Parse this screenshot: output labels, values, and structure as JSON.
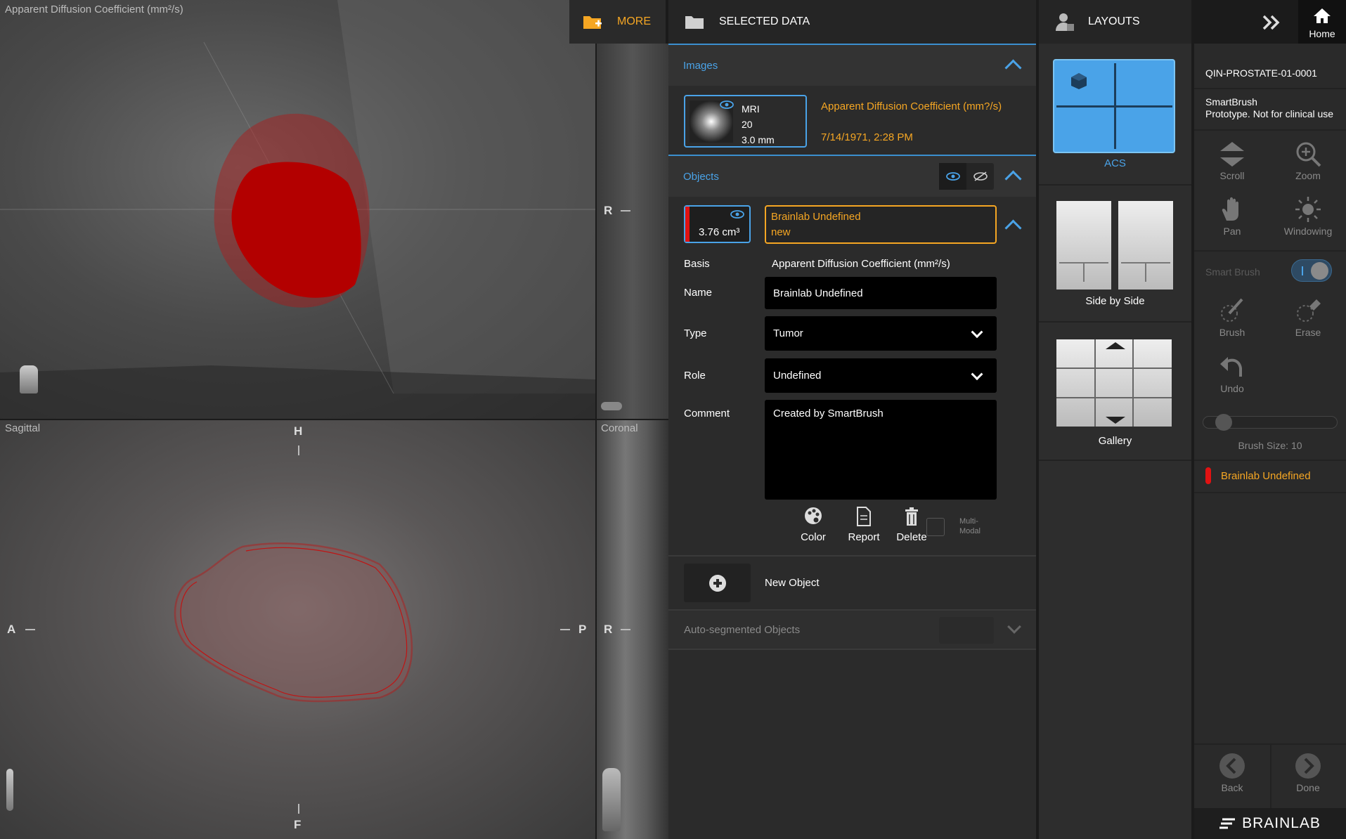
{
  "viewer": {
    "top_label": "Apparent Diffusion Coefficient (mm²/s)",
    "sagittal_label": "Sagittal",
    "coronal_label": "Coronal",
    "orient_3d_r": "R",
    "orient_sag_h": "H",
    "orient_sag_f": "F",
    "orient_sag_a": "A",
    "orient_sag_p": "P",
    "orient_cor_r": "R"
  },
  "more_button": {
    "label": "MORE"
  },
  "selected_data": {
    "title": "SELECTED DATA",
    "images": {
      "section_label": "Images",
      "modality": "MRI",
      "count": "20",
      "thickness": "3.0 mm",
      "description": "Apparent Diffusion Coefficient (mm?/s)",
      "date": "7/14/1971, 2:28 PM"
    },
    "objects": {
      "section_label": "Objects",
      "volume": "3.76 cm³",
      "name_title": "Brainlab Undefined",
      "name_sub": "new",
      "basis_label": "Basis",
      "basis_value": "Apparent Diffusion Coefficient (mm²/s)",
      "name_label": "Name",
      "name_value": "Brainlab Undefined",
      "type_label": "Type",
      "type_value": "Tumor",
      "role_label": "Role",
      "role_value": "Undefined",
      "comment_label": "Comment",
      "comment_value": "Created by SmartBrush",
      "color_label": "Color",
      "report_label": "Report",
      "delete_label": "Delete",
      "multimodal_label_1": "Multi-",
      "multimodal_label_2": "Modal",
      "new_object_label": "New Object",
      "auto_segmented_label": "Auto-segmented Objects"
    }
  },
  "layouts": {
    "title": "LAYOUTS",
    "items": [
      {
        "label": "ACS"
      },
      {
        "label": "Side by Side"
      },
      {
        "label": "Gallery"
      }
    ]
  },
  "home": {
    "label": "Home"
  },
  "tools": {
    "patient_id": "QIN-PROSTATE-01-0001",
    "app_name": "SmartBrush",
    "app_note": "Prototype. Not for clinical use",
    "scroll": "Scroll",
    "zoom": "Zoom",
    "pan": "Pan",
    "windowing": "Windowing",
    "smart_brush": "Smart Brush",
    "brush": "Brush",
    "erase": "Erase",
    "undo": "Undo",
    "brush_size": "Brush Size: 10",
    "brush_size_value": 10,
    "active_object": "Brainlab Undefined",
    "back": "Back",
    "done": "Done",
    "brand": "BRAINLAB"
  },
  "colors": {
    "accent_blue": "#4aa3e8",
    "accent_orange": "#f5a623",
    "object_red": "#e11212"
  }
}
